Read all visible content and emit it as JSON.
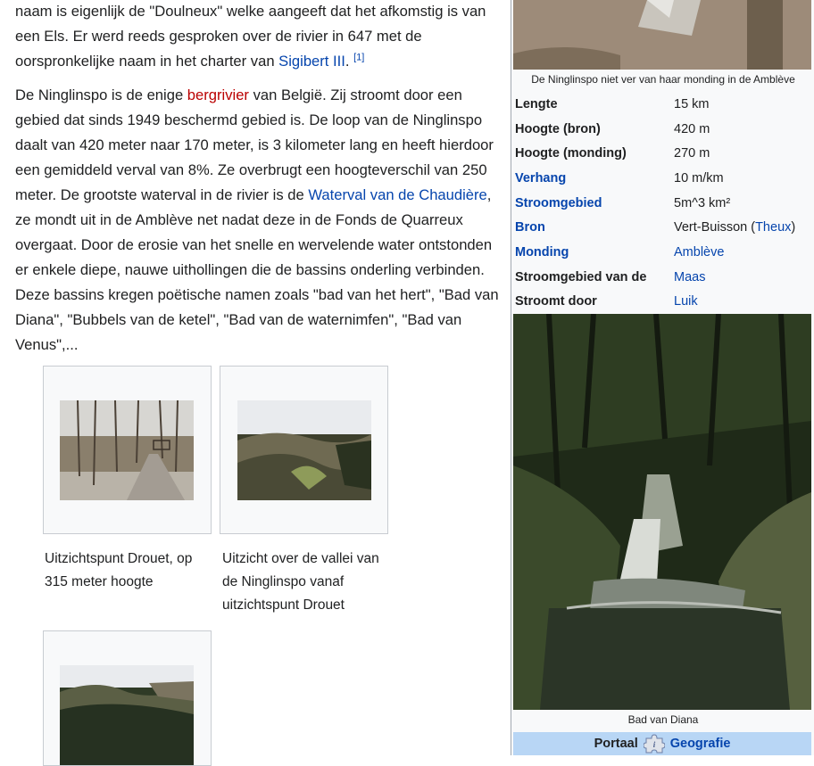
{
  "article": {
    "p1": {
      "line_a": "naam is eigenlijk de \"Doulneux\" welke aangeeft dat het afkomstig is van een Els. Er werd reeds gesproken over de rivier in 647 met de oorspronkelijke naam in het charter van ",
      "link_sigibert": "Sigibert III",
      "after_link": ". ",
      "ref": "[1]"
    },
    "p2": {
      "t1": "De Ninglinspo is de enige ",
      "link_bergrivier": "bergrivier",
      "t2": " van België. Zij stroomt door een gebied dat sinds 1949 beschermd gebied is. De loop van de Ninglinspo daalt van 420 meter naar 170 meter, is 3 kilometer lang en heeft hierdoor een gemiddeld verval van 8%. Ze overbrugt een hoogteverschil van 250 meter. De grootste waterval in de rivier is de ",
      "link_waterval": "Waterval van de Chaudière",
      "t3": ", ze mondt uit in de Amblève net nadat deze in de Fonds de Quarreux overgaat. Door de erosie van het snelle en wervelende water ontstonden er enkele diepe, nauwe uithollingen die de bassins onderling verbinden. Deze bassins kregen poëtische namen zoals \"bad van het hert\", \"Bad van Diana\", \"Bubbels van de ketel\", \"Bad van de waternimfen\", \"Bad van Venus\",..."
    }
  },
  "gallery": [
    {
      "caption": "Uitzichtspunt Drouet, op 315 meter hoogte"
    },
    {
      "caption": "Uitzicht over de vallei van de Ninglinspo vanaf uitzichtspunt Drouet"
    },
    {
      "caption": ""
    }
  ],
  "infobox": {
    "top_caption": "De Ninglinspo niet ver van haar monding in de Amblève",
    "rows": [
      {
        "key": "Lengte",
        "value": "15 km"
      },
      {
        "key": "Hoogte (bron)",
        "value": "420 m"
      },
      {
        "key": "Hoogte (monding)",
        "value": "270 m"
      },
      {
        "key": "Verhang",
        "value": "10 m/km"
      },
      {
        "key": "Stroomgebied",
        "value": "5m^3 km²"
      },
      {
        "key": "Bron",
        "value_a": "Vert-Buisson (",
        "value_link": "Theux",
        "value_b": ")"
      },
      {
        "key": "Monding",
        "value": "Amblève"
      },
      {
        "key": "Stroomgebied van de",
        "value": "Maas"
      },
      {
        "key": "Stroomt door",
        "value": "Luik"
      }
    ],
    "bottom_caption": "Bad van Diana",
    "portaal_label": "Portaal",
    "portaal_link": "Geografie"
  }
}
